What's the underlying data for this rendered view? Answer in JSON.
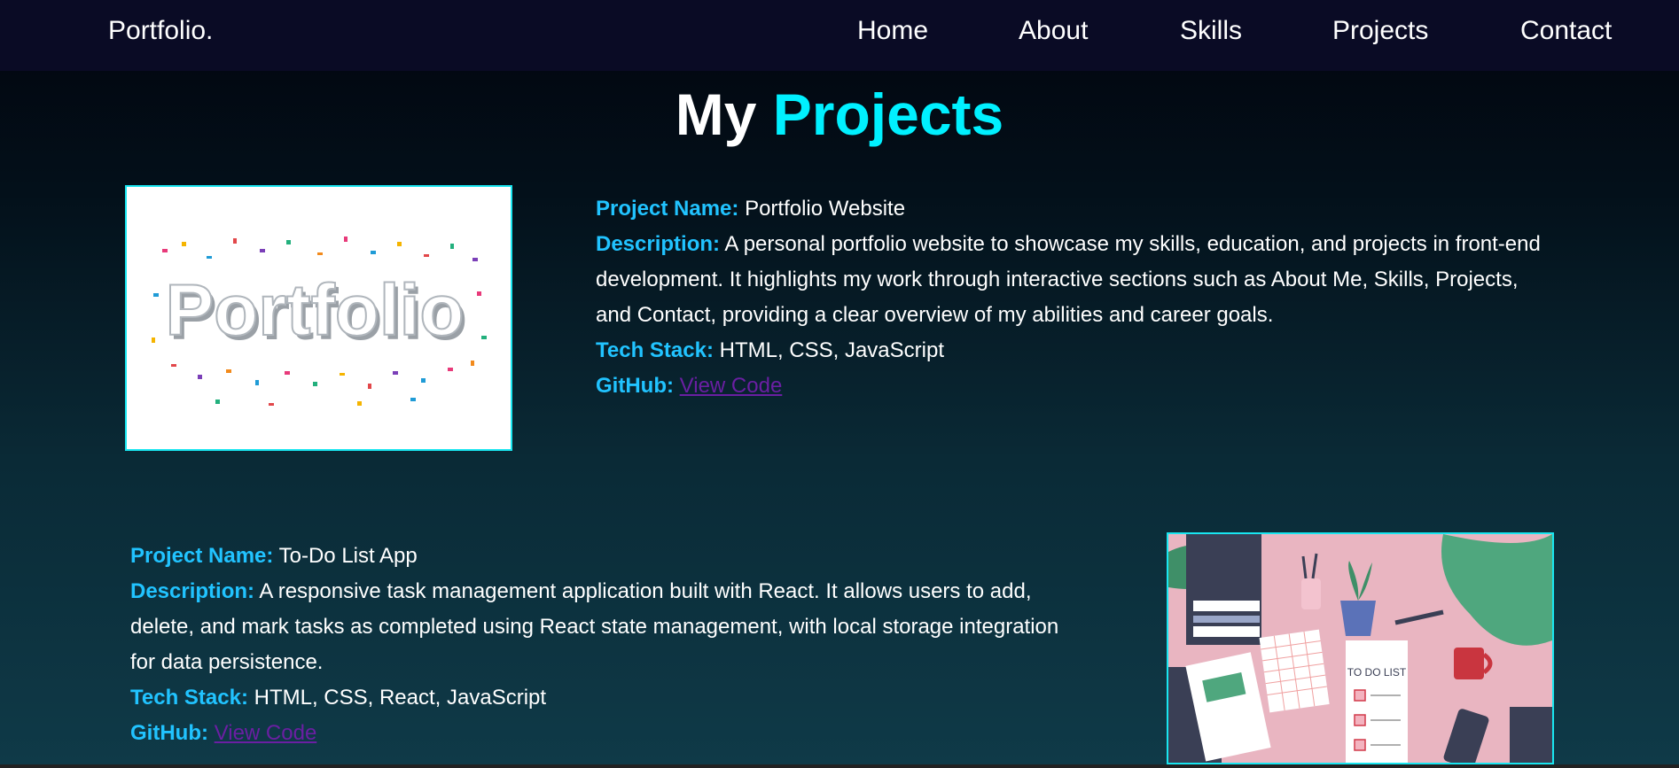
{
  "nav": {
    "brand": "Portfolio.",
    "items": [
      "Home",
      "About",
      "Skills",
      "Projects",
      "Contact"
    ]
  },
  "section": {
    "title_part1": "My",
    "title_part2": "Projects"
  },
  "projects": [
    {
      "name_label": "Project Name:",
      "name": "Portfolio Website",
      "desc_label": "Description:",
      "description": "A personal portfolio website to showcase my skills, education, and projects in front-end development. It highlights my work through interactive sections such as About Me, Skills, Projects, and Contact, providing a clear overview of my abilities and career goals.",
      "tech_label": "Tech Stack:",
      "tech": "HTML, CSS, JavaScript",
      "github_label": "GitHub:",
      "github_link": "View Code",
      "image_text": "Portfolio"
    },
    {
      "name_label": "Project Name:",
      "name": "To-Do List App",
      "desc_label": "Description:",
      "description": "A responsive task management application built with React. It allows users to add, delete, and mark tasks as completed using React state management, with local storage integration for data persistence.",
      "tech_label": "Tech Stack:",
      "tech": "HTML, CSS, React, JavaScript",
      "github_label": "GitHub:",
      "github_link": "View Code",
      "image_text": "TO DO LIST"
    }
  ],
  "colors": {
    "accent": "#00f0ff",
    "label": "#21c3ff",
    "link": "#6a1fa2",
    "nav_bg": "#0a0b25"
  }
}
